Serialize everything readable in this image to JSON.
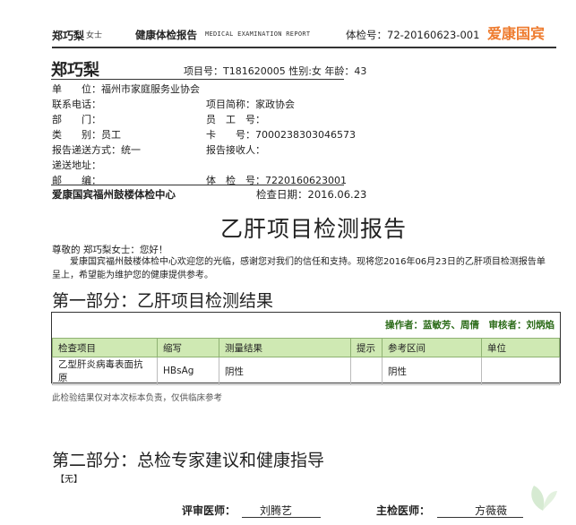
{
  "header": {
    "name": "郑巧梨",
    "gender": "女士",
    "title": "健康体检报告",
    "subtitle": "MEDICAL EXAMINATION REPORT",
    "exam_no": "体检号：72-20160623-001",
    "brand": "爱康国宾"
  },
  "patient": {
    "name": "郑巧梨",
    "project_line": "项目号：T181620005  性别:女  年龄：43"
  },
  "info": {
    "unit_label": "单　　位：",
    "unit_value": "福州市家庭服务业协会",
    "phone_label": "联系电话：",
    "proj_abbr_label": "项目简称：",
    "proj_abbr_value": "家政协会",
    "dept_label": "部　　门：",
    "emp_no_label": "员　工　号：",
    "type_label": "类　　别：",
    "type_value": "员工",
    "card_label": "卡　　号：",
    "card_value": "7000238303046573",
    "delivery_label": "报告递送方式：",
    "delivery_value": "统一",
    "receiver_label": "报告接收人：",
    "address_label": "递送地址：",
    "postal_label": "邮　　编：",
    "exam_no_label": "体　检　号：",
    "exam_no_value": "7220160623001"
  },
  "center": {
    "name": "爱康国宾福州鼓楼体检中心",
    "check_date": "检查日期：2016.06.23"
  },
  "report_title": "乙肝项目检测报告",
  "greeting": "尊敬的 郑巧梨女士：您好！",
  "intro": "爱康国宾福州鼓楼体检中心欢迎您的光临，感谢您对我们的信任和支持。现将您2016年06月23日的乙肝项目检测报告单呈上，希望能为维护您的健康提供参考。",
  "section1_title": "第一部分：乙肝项目检测结果",
  "operator_line": "操作者：蓝敏芳、周倩　审核者：刘炳焰",
  "table": {
    "headers": [
      "检查项目",
      "缩写",
      "测量结果",
      "提示",
      "参考区间",
      "单位"
    ],
    "rows": [
      [
        "乙型肝炎病毒表面抗原",
        "HBsAg",
        "阴性",
        "",
        "阴性",
        ""
      ]
    ]
  },
  "note": "此检验结果仅对本次标本负责，仅供临床参考",
  "section2_title": "第二部分：总检专家建议和健康指导",
  "section2_content": "【无】",
  "signatures": {
    "reviewer_label": "评审医师：",
    "reviewer_name": "刘腾艺",
    "chief_label": "主检医师：",
    "chief_name": "方薇薇"
  },
  "colors": {
    "brand": "#ee7b2e",
    "table_header_bg": "#cfe9b3",
    "operator_text": "#2a6a17"
  },
  "icons": [
    "leaf-logo-icon"
  ]
}
